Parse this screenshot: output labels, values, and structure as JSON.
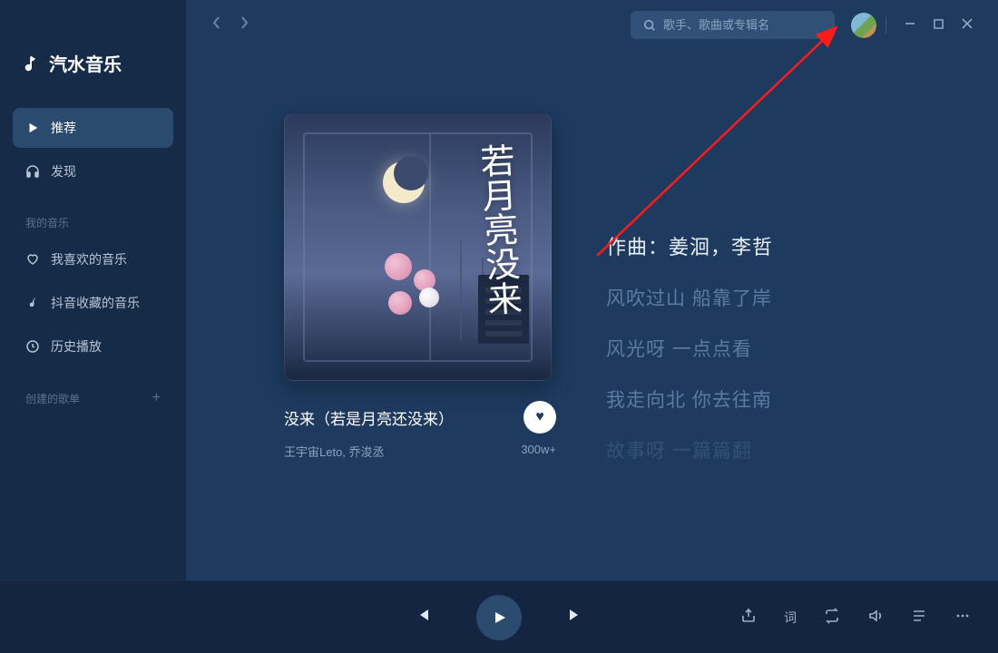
{
  "app": {
    "name": "汽水音乐"
  },
  "sidebar": {
    "nav": [
      {
        "label": "推荐",
        "icon": "play"
      },
      {
        "label": "发现",
        "icon": "headphones"
      }
    ],
    "mymusic_title": "我的音乐",
    "mymusic": [
      {
        "label": "我喜欢的音乐",
        "icon": "heart"
      },
      {
        "label": "抖音收藏的音乐",
        "icon": "note"
      },
      {
        "label": "历史播放",
        "icon": "clock"
      }
    ],
    "playlist_title": "创建的歌单"
  },
  "search": {
    "placeholder": "歌手、歌曲或专辑名"
  },
  "song": {
    "title": "没来（若是月亮还没来）",
    "artist": "王宇宙Leto, 乔浚丞",
    "plays": "300w+",
    "cover_calligraphy": "若月亮没来"
  },
  "lyrics": [
    {
      "text": "作曲：姜洄，李哲",
      "state": "current"
    },
    {
      "text": "风吹过山 船靠了岸",
      "state": ""
    },
    {
      "text": "风光呀 一点点看",
      "state": ""
    },
    {
      "text": "我走向北 你去往南",
      "state": ""
    },
    {
      "text": "故事呀 一篇篇翻",
      "state": "fade"
    }
  ],
  "player": {
    "lyric_word": "词"
  }
}
